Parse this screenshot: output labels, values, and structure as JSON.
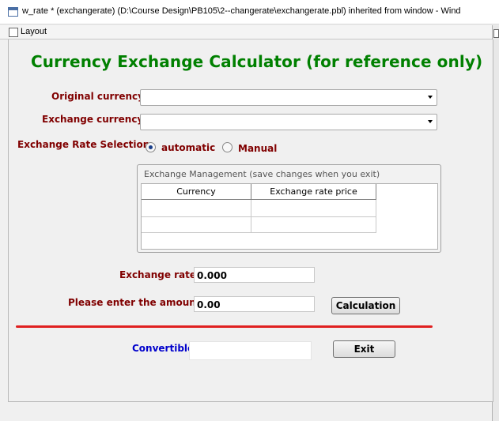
{
  "window": {
    "title": "w_rate * (exchangerate) (D:\\Course Design\\PB105\\2--changerate\\exchangerate.pbl) inherited from window - Wind",
    "layout_tab": "Layout"
  },
  "form": {
    "heading": "Currency Exchange Calculator (for reference only)",
    "original_currency_label": "Original currency",
    "original_currency_value": "",
    "exchange_currency_label": "Exchange currency",
    "exchange_currency_value": "",
    "rate_selection_label": "Exchange Rate Selection",
    "radio_automatic": "automatic",
    "radio_manual": "Manual",
    "selected_mode": "automatic"
  },
  "management": {
    "group_title": "Exchange Management (save changes when you exit)",
    "columns": [
      "Currency",
      "Exchange rate price"
    ],
    "rows": []
  },
  "rate": {
    "label": "Exchange rate",
    "value": "0.000"
  },
  "amount": {
    "label": "Please enter the amount",
    "value": "0.00",
    "calc_button": "Calculation"
  },
  "result": {
    "label": "Convertible",
    "value": "",
    "exit_button": "Exit"
  },
  "colors": {
    "heading": "#008000",
    "label": "#800000",
    "result_label": "#0000cc",
    "divider": "#e02020"
  }
}
